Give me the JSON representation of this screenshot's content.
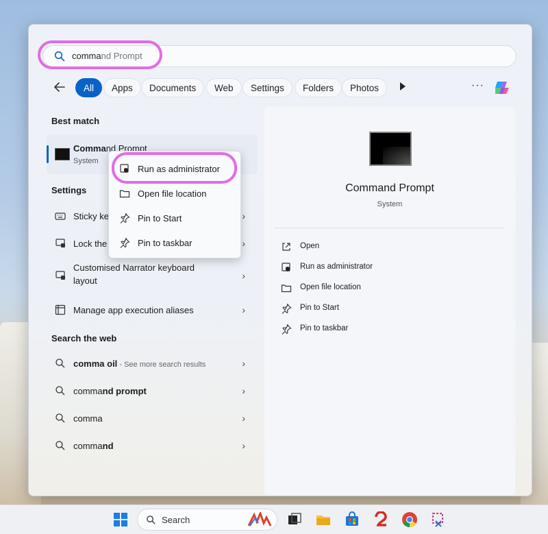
{
  "search": {
    "typed": "comma",
    "completion": "nd Prompt"
  },
  "filters": {
    "chips": [
      "All",
      "Apps",
      "Documents",
      "Web",
      "Settings",
      "Folders",
      "Photos"
    ],
    "more": "···"
  },
  "best_match": {
    "heading": "Best match",
    "title_bold": "Comma",
    "title_rest": "nd Prompt",
    "subtitle": "System"
  },
  "settings_section": {
    "heading": "Settings",
    "items": [
      {
        "label": "Sticky keys"
      },
      {
        "label": "Lock the"
      },
      {
        "label_line1": "Customised Narrator keyboard",
        "label_line2": "layout"
      },
      {
        "label": "Manage app execution aliases"
      }
    ]
  },
  "web_section": {
    "heading": "Search the web",
    "items": [
      {
        "bold": "comma oil",
        "rest": "",
        "sub": " - See more search results"
      },
      {
        "bold": "comma",
        "rest": "nd prompt"
      },
      {
        "bold": "comma",
        "rest": ""
      },
      {
        "bold": "comma",
        "rest": "nd"
      }
    ]
  },
  "context_menu": {
    "items": [
      "Run as administrator",
      "Open file location",
      "Pin to Start",
      "Pin to taskbar"
    ]
  },
  "preview": {
    "title": "Command Prompt",
    "subtitle": "System",
    "actions": [
      "Open",
      "Run as administrator",
      "Open file location",
      "Pin to Start",
      "Pin to taskbar"
    ]
  },
  "taskbar": {
    "search_label": "Search"
  },
  "colors": {
    "accent": "#0a62c7",
    "highlight": "#e26be6"
  }
}
